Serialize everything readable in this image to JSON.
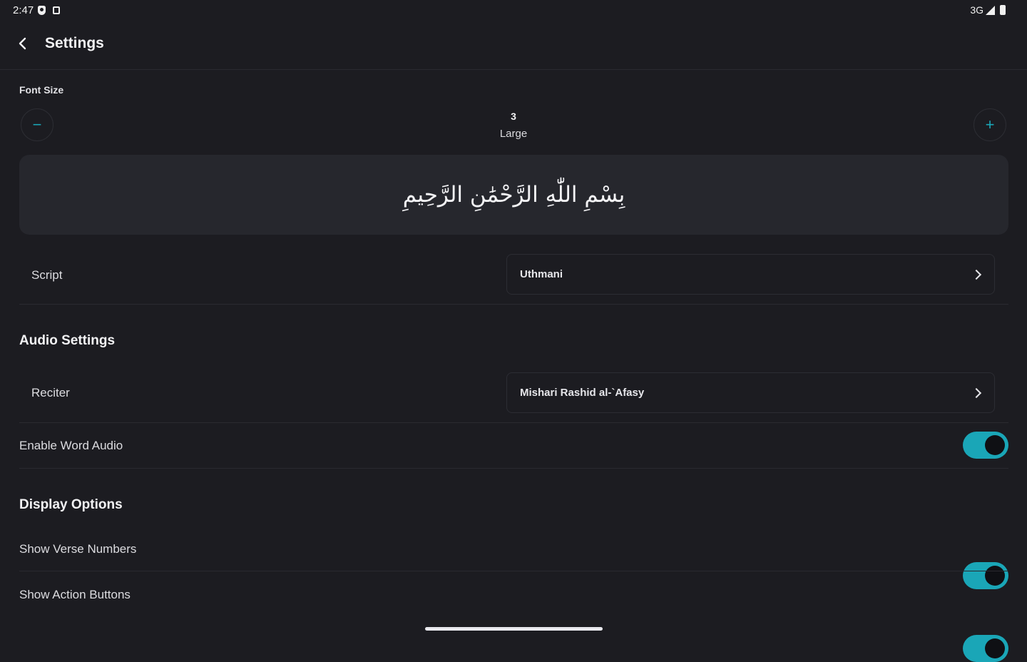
{
  "status": {
    "time": "2:47",
    "network": "3G"
  },
  "header": {
    "title": "Settings"
  },
  "font_size": {
    "label": "Font Size",
    "decrease": "−",
    "increase": "+",
    "value": "3",
    "value_name": "Large",
    "preview_text": "بِسْمِ اللّٰهِ الرَّحْمَٰنِ الرَّحِيمِ"
  },
  "script": {
    "label": "Script",
    "value": "Uthmani"
  },
  "audio": {
    "title": "Audio Settings",
    "reciter_label": "Reciter",
    "reciter_value": "Mishari Rashid al-`Afasy",
    "word_audio_label": "Enable Word Audio",
    "word_audio_on": true
  },
  "display": {
    "title": "Display Options",
    "verse_numbers_label": "Show Verse Numbers",
    "verse_numbers_on": true,
    "action_buttons_label": "Show Action Buttons",
    "action_buttons_on": true
  },
  "colors": {
    "accent": "#1aa6b7",
    "background": "#1c1c21",
    "surface": "#26272d"
  },
  "icons": {
    "back": "arrow-left-icon",
    "chevron": "chevron-right-icon"
  }
}
